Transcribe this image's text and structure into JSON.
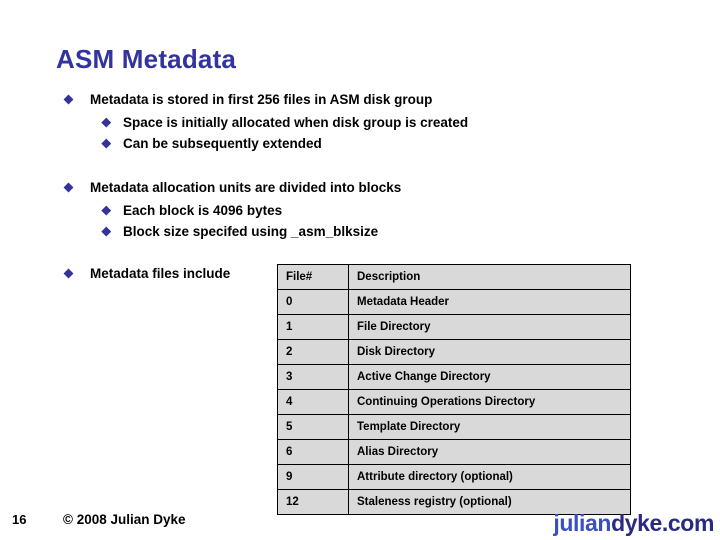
{
  "slide": {
    "title": "ASM Metadata",
    "bullets": [
      {
        "level1": "Metadata is stored in first 256 files in ASM disk group",
        "level2": [
          "Space is initially allocated when disk group is created",
          "Can be subsequently extended"
        ]
      },
      {
        "level1": "Metadata allocation units are divided into blocks",
        "level2": [
          "Each block is 4096 bytes",
          "Block size specifed using _asm_blksize"
        ]
      },
      {
        "level1": "Metadata files include",
        "level2": []
      }
    ],
    "table": {
      "headers": [
        "File#",
        "Description"
      ],
      "rows": [
        {
          "file": "0",
          "description": "Metadata Header"
        },
        {
          "file": "1",
          "description": "File Directory"
        },
        {
          "file": "2",
          "description": "Disk Directory"
        },
        {
          "file": "3",
          "description": "Active Change Directory"
        },
        {
          "file": "4",
          "description": "Continuing Operations Directory"
        },
        {
          "file": "5",
          "description": "Template Directory"
        },
        {
          "file": "6",
          "description": "Alias Directory"
        },
        {
          "file": "9",
          "description": "Attribute directory (optional)"
        },
        {
          "file": "12",
          "description": "Staleness registry (optional)"
        }
      ]
    },
    "footer": {
      "slide_number": "16",
      "copyright": "© 2008 Julian Dyke",
      "logo_part_a": "julian",
      "logo_part_b": "dyke.com"
    },
    "colors": {
      "title": "#3333A0",
      "bullet_marker": "#333399",
      "table_fill": "#D9D9D9",
      "table_border": "#000000",
      "logo_a": "#3A4FC4",
      "logo_b": "#2A2A80"
    }
  }
}
